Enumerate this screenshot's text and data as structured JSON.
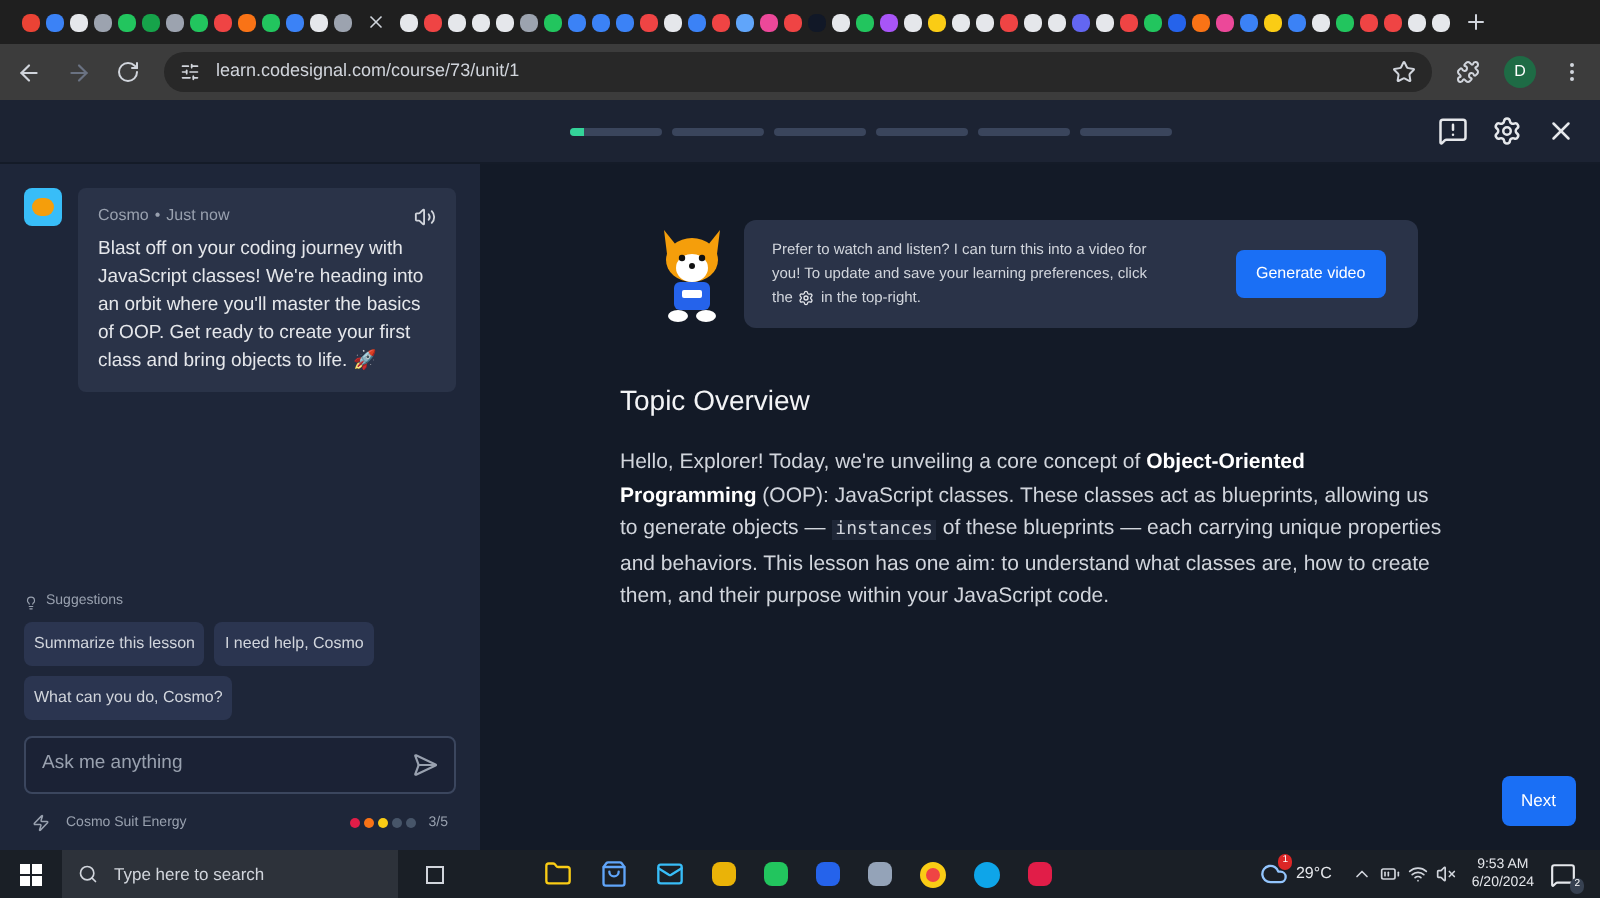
{
  "browser": {
    "url": "learn.codesignal.com/course/73/unit/1",
    "profile_initial": "D"
  },
  "lesson": {
    "progress": [
      {
        "level": 0.15
      },
      {
        "level": 0
      },
      {
        "level": 0
      },
      {
        "level": 0
      },
      {
        "level": 0
      },
      {
        "level": 0
      }
    ]
  },
  "chat": {
    "message": {
      "sender": "Cosmo",
      "separator": "•",
      "time": "Just now",
      "text": "Blast off on your coding journey with JavaScript classes! We're heading into an orbit where you'll master the basics of OOP. Get ready to create your first class and bring objects to life. 🚀"
    },
    "suggestions_label": "Suggestions",
    "suggestions": [
      "Summarize this lesson",
      "I need help, Cosmo",
      "What can you do, Cosmo?"
    ],
    "input": {
      "placeholder": "Ask me anything"
    },
    "energy": {
      "label": "Cosmo Suit Energy",
      "dots": [
        {
          "color": "#e11d48"
        },
        {
          "color": "#f97316"
        },
        {
          "color": "#facc15"
        },
        {
          "color": "#475569"
        },
        {
          "color": "#475569"
        }
      ],
      "reading": "3/5"
    }
  },
  "content": {
    "callout": {
      "lines": [
        "Prefer to watch and listen? I can turn this into a video for",
        "you! To update and save your learning preferences, click"
      ],
      "text_before": "the",
      "text_after": "in the top-right.",
      "button": "Generate video"
    },
    "heading": "Topic Overview",
    "paragraph": {
      "before": "Hello, Explorer! Today, we're unveiling a core concept of **Object-Oriented Programming** (OOP): JavaScript classes. These classes act as blueprints, allowing us to generate objects —",
      "code": "instances",
      "after": "of these blueprints — each carrying unique properties and behaviors. This lesson has one aim: to understand what classes are, how to create them, and their purpose within your JavaScript code."
    },
    "next_button": "Next"
  },
  "taskbar": {
    "search_placeholder": "Type here to search",
    "weather": {
      "temp": "29°C",
      "badge": "1"
    },
    "time": "9:53 AM",
    "date": "6/20/2024",
    "notification_count": "2"
  }
}
